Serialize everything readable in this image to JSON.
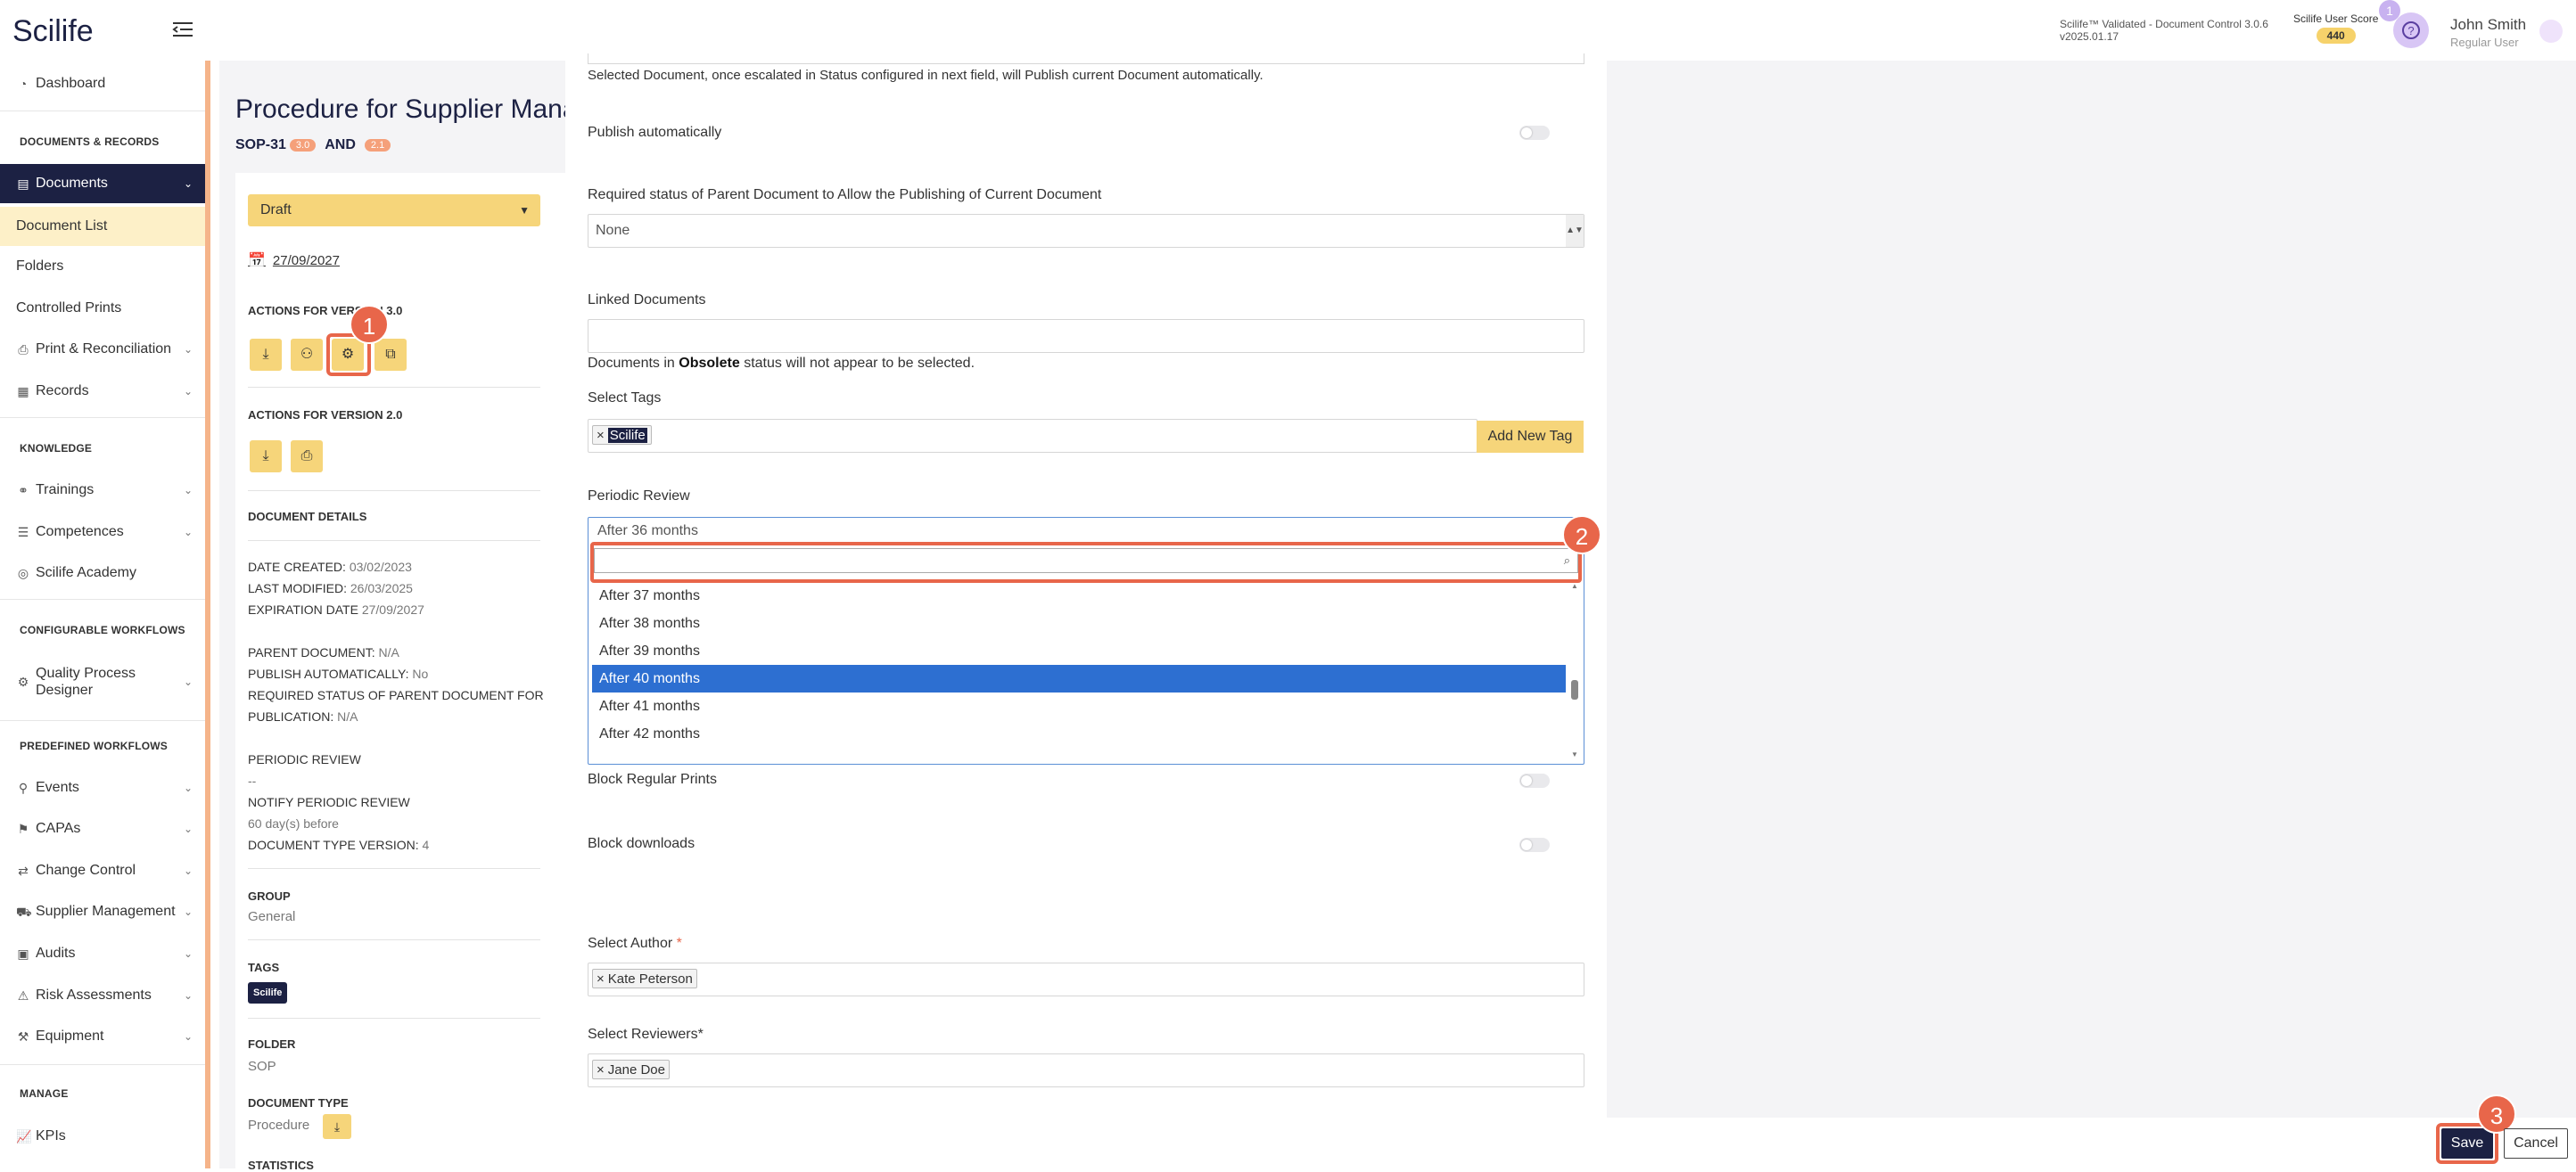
{
  "app": {
    "logo": "Scilife"
  },
  "header": {
    "version_line1": "Scilife™ Validated - Document Control 3.0.6",
    "version_line2": "v2025.01.17",
    "score_label": "Scilife User Score",
    "score_value": "440",
    "help_badge": "1",
    "user_name": "John Smith",
    "user_role": "Regular User"
  },
  "sidebar": {
    "dashboard": "Dashboard",
    "section_docs": "DOCUMENTS & RECORDS",
    "documents": "Documents",
    "document_list": "Document List",
    "folders": "Folders",
    "controlled_prints": "Controlled Prints",
    "print_reconciliation": "Print & Reconciliation",
    "records": "Records",
    "section_knowledge": "KNOWLEDGE",
    "trainings": "Trainings",
    "competences": "Competences",
    "academy": "Scilife Academy",
    "section_configurable": "CONFIGURABLE WORKFLOWS",
    "qpd_line1": "Quality Process",
    "qpd_line2": "Designer",
    "section_predefined": "PREDEFINED WORKFLOWS",
    "events": "Events",
    "capas": "CAPAs",
    "change_control": "Change Control",
    "supplier_management": "Supplier Management",
    "audits": "Audits",
    "risk_assessments": "Risk Assessments",
    "equipment": "Equipment",
    "section_manage": "MANAGE",
    "kpis": "KPIs"
  },
  "doc": {
    "title": "Procedure for Supplier Management",
    "code": "SOP-31",
    "version_a": "3.0",
    "and": "AND",
    "version_b": "2.1",
    "status": "Draft",
    "date": "27/09/2027",
    "actions_v3": "ACTIONS FOR VERSION 3.0",
    "actions_v2": "ACTIONS FOR VERSION 2.0",
    "details_heading": "DOCUMENT DETAILS",
    "date_created_label": "DATE CREATED:",
    "date_created": "03/02/2023",
    "last_modified_label": "LAST MODIFIED:",
    "last_modified": "26/03/2025",
    "expiration_label": "EXPIRATION DATE",
    "expiration": "27/09/2027",
    "parent_label": "PARENT DOCUMENT:",
    "parent": "N/A",
    "publish_label": "PUBLISH AUTOMATICALLY:",
    "publish": "No",
    "req_status_line1": "REQUIRED STATUS OF PARENT DOCUMENT FOR",
    "req_status_line2": "PUBLICATION:",
    "req_status": "N/A",
    "periodic_label": "PERIODIC REVIEW",
    "periodic": "--",
    "notify_label": "NOTIFY PERIODIC REVIEW",
    "notify": "60 day(s) before",
    "doctype_version_label": "DOCUMENT TYPE VERSION:",
    "doctype_version": "4",
    "group_label": "GROUP",
    "group": "General",
    "tags_label": "TAGS",
    "tag": "Scilife",
    "folder_label": "FOLDER",
    "folder": "SOP",
    "doc_type_label": "DOCUMENT TYPE",
    "doc_type": "Procedure",
    "statistics_label": "STATISTICS"
  },
  "form": {
    "auto_publish_note": "Selected Document, once escalated in Status configured in next field, will Publish current Document automatically.",
    "publish_auto_label": "Publish automatically",
    "required_status_label": "Required status of Parent Document to Allow the Publishing of Current Document",
    "required_status_value": "None",
    "linked_docs_label": "Linked Documents",
    "obsolete_note_pre": "Documents in",
    "obsolete_note_bold": "Obsolete",
    "obsolete_note_post": "status will not appear to be selected.",
    "select_tags_label": "Select Tags",
    "tag_chip": "Scilife",
    "add_new_tag": "Add New Tag",
    "periodic_review_label": "Periodic Review",
    "periodic_current": "After 36 months",
    "options": [
      "After 37 months",
      "After 38 months",
      "After 39 months",
      "After 40 months",
      "After 41 months",
      "After 42 months"
    ],
    "selected_option": "After 40 months",
    "block_prints_label": "Block Regular Prints",
    "block_downloads_label": "Block downloads",
    "select_author_label": "Select Author",
    "author_required_mark": "*",
    "author_chip": "Kate Peterson",
    "select_reviewers_label": "Select Reviewers*",
    "reviewer_chip": "Jane Doe",
    "save": "Save",
    "cancel": "Cancel"
  },
  "markers": {
    "m1": "1",
    "m2": "2",
    "m3": "3"
  },
  "colors": {
    "navy": "#1c2143",
    "yellow": "#f6d57a",
    "accent": "#e8664a",
    "selection": "#2d6fd1"
  }
}
